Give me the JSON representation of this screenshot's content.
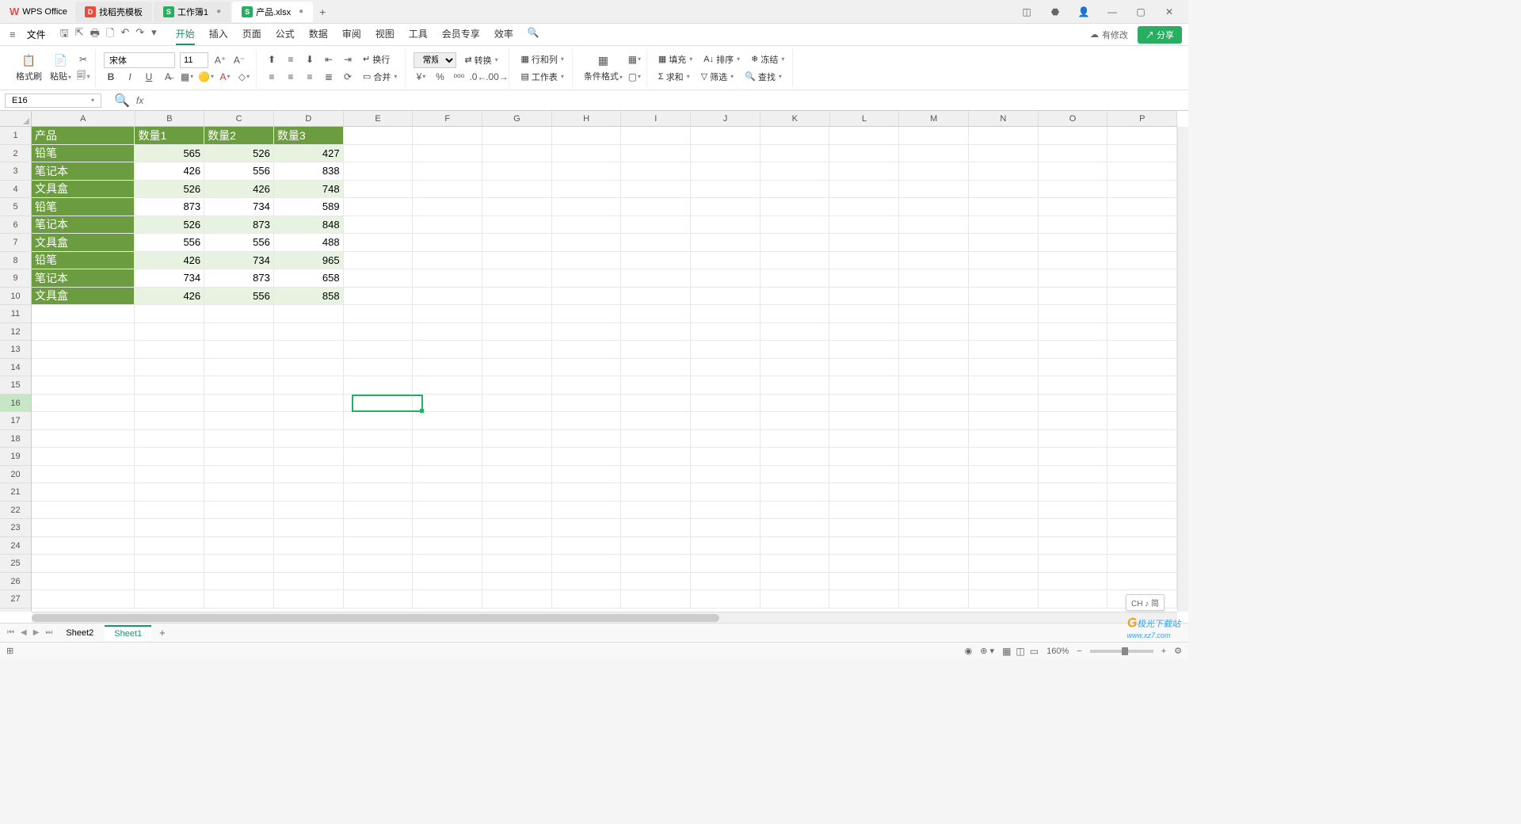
{
  "app": {
    "name": "WPS Office"
  },
  "tabs": [
    {
      "label": "找稻壳模板",
      "icon": "red"
    },
    {
      "label": "工作簿1",
      "icon": "green"
    },
    {
      "label": "产品.xlsx",
      "icon": "green",
      "active": true
    }
  ],
  "menu": {
    "file": "文件",
    "items": [
      "开始",
      "插入",
      "页面",
      "公式",
      "数据",
      "审阅",
      "视图",
      "工具",
      "会员专享",
      "效率"
    ],
    "active": "开始",
    "modified": "有修改",
    "share": "分享"
  },
  "ribbon": {
    "format_painter": "格式刷",
    "paste": "粘贴",
    "font_name": "宋体",
    "font_size": "11",
    "wrap": "换行",
    "merge": "合并",
    "number_format": "常规",
    "convert": "转换",
    "row_col": "行和列",
    "worksheet": "工作表",
    "cond_format": "条件格式",
    "fill": "填充",
    "sort": "排序",
    "freeze": "冻结",
    "sum": "求和",
    "filter": "筛选",
    "find": "查找"
  },
  "cell_ref": "E16",
  "columns": [
    "A",
    "B",
    "C",
    "D",
    "E",
    "F",
    "G",
    "H",
    "I",
    "J",
    "K",
    "L",
    "M",
    "N",
    "O",
    "P"
  ],
  "row_numbers": [
    1,
    2,
    3,
    4,
    5,
    6,
    7,
    8,
    9,
    10,
    11,
    12,
    13,
    14,
    15,
    16,
    17,
    18,
    19,
    20,
    21,
    22,
    23,
    24,
    25,
    26,
    27
  ],
  "active_row": 16,
  "selected_cell": {
    "col": 4,
    "row": 15
  },
  "headers": [
    "产品",
    "数量1",
    "数量2",
    "数量3"
  ],
  "data_rows": [
    {
      "name": "铅笔",
      "v": [
        565,
        526,
        427
      ],
      "alt": true
    },
    {
      "name": "笔记本",
      "v": [
        426,
        556,
        838
      ],
      "alt": false
    },
    {
      "name": "文具盒",
      "v": [
        526,
        426,
        748
      ],
      "alt": true
    },
    {
      "name": "铅笔",
      "v": [
        873,
        734,
        589
      ],
      "alt": false
    },
    {
      "name": "笔记本",
      "v": [
        526,
        873,
        848
      ],
      "alt": true
    },
    {
      "name": "文具盒",
      "v": [
        556,
        556,
        488
      ],
      "alt": false
    },
    {
      "name": "铅笔",
      "v": [
        426,
        734,
        965
      ],
      "alt": true
    },
    {
      "name": "笔记本",
      "v": [
        734,
        873,
        658
      ],
      "alt": false
    },
    {
      "name": "文具盒",
      "v": [
        426,
        556,
        858
      ],
      "alt": true
    }
  ],
  "sheets": [
    {
      "name": "Sheet2"
    },
    {
      "name": "Sheet1",
      "active": true
    }
  ],
  "status": {
    "ime": "CH ♪ 简",
    "zoom": "160%"
  },
  "watermark": {
    "brand": "极光下载站",
    "url": "www.xz7.com"
  }
}
